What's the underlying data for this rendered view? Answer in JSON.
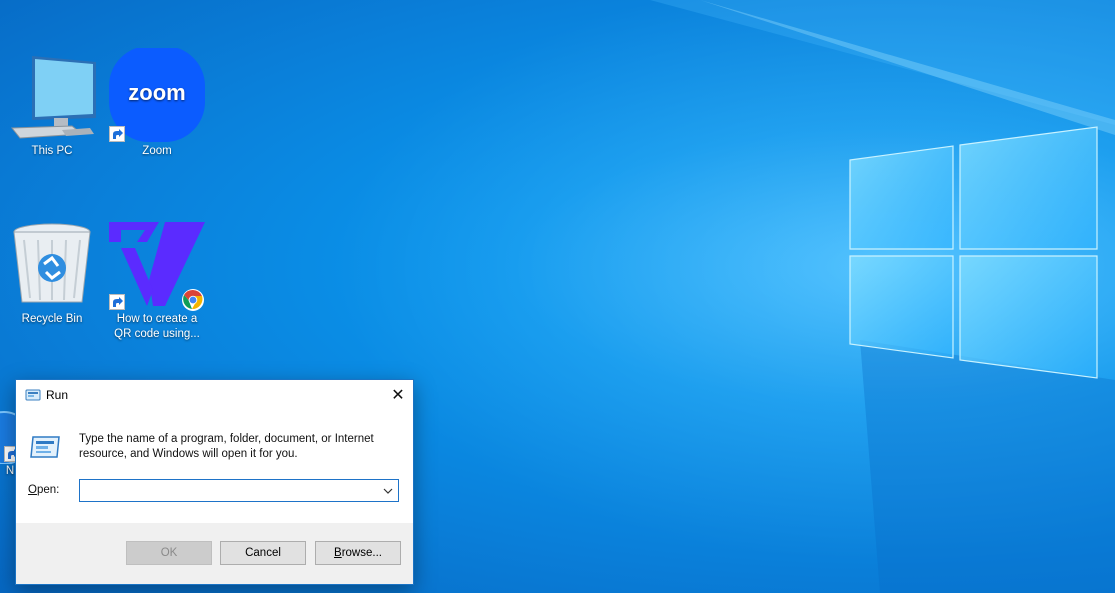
{
  "desktop": {
    "icons": [
      {
        "label": "This PC",
        "icon": "this-pc-icon"
      },
      {
        "label": "Zoom",
        "icon": "zoom-icon",
        "shortcut": true,
        "logo_text": "zoom",
        "color": "#0b5cff"
      },
      {
        "label": "Recycle Bin",
        "icon": "recycle-bin-icon"
      },
      {
        "label_line1": "How to create a",
        "label_line2": "QR code using...",
        "icon": "veed-logo-icon",
        "shortcut": true,
        "color": "#5b2bff"
      }
    ],
    "partial_icon_label": "N"
  },
  "run_dialog": {
    "title": "Run",
    "close_glyph": "✕",
    "description": "Type the name of a program, folder, document, or Internet resource, and Windows will open it for you.",
    "open_label_key": "O",
    "open_label_rest": "pen:",
    "open_value": "",
    "dropdown_glyph": "⌵",
    "ok_label": "OK",
    "cancel_label": "Cancel",
    "browse_label_key": "B",
    "browse_label_rest": "rowse...",
    "ok_enabled": false,
    "accent_color": "#1e73c8"
  }
}
